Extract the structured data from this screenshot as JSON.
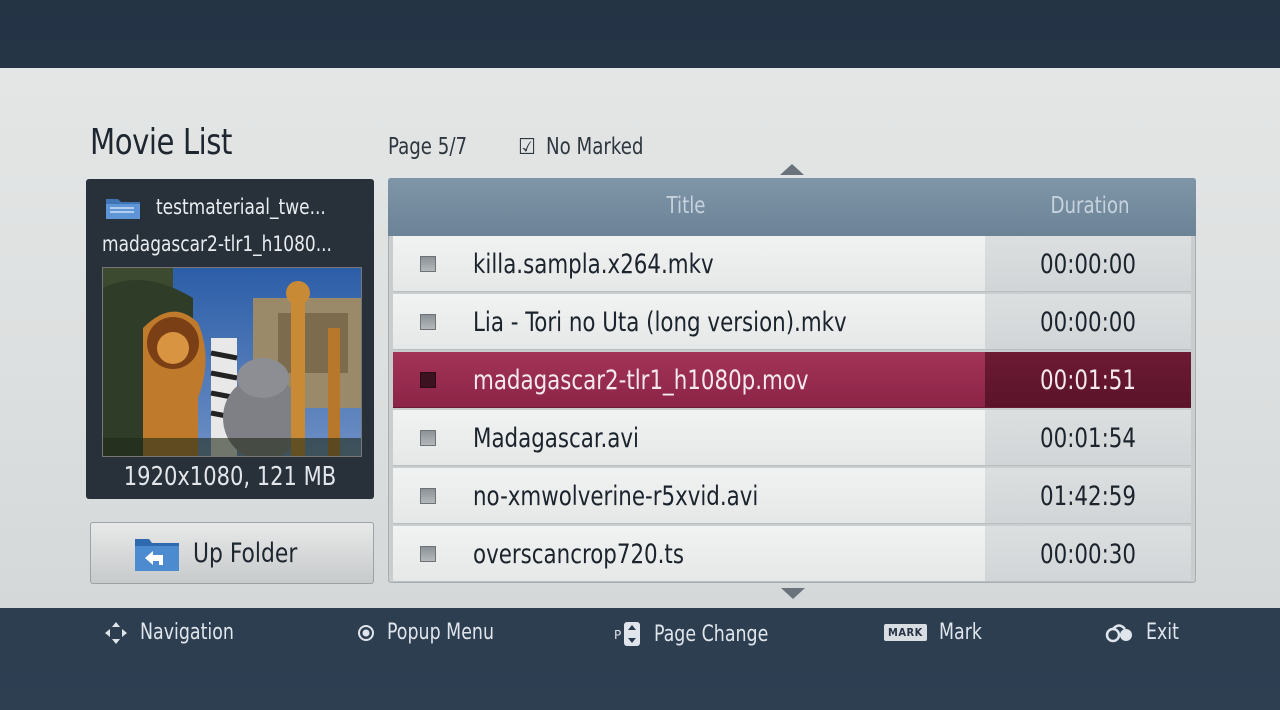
{
  "header": {
    "title": "Movie List",
    "page_indicator": "Page 5/7",
    "marked_status": "No Marked"
  },
  "preview": {
    "folder_name": "testmateriaal_twe...",
    "file_name": "madagascar2-tlr1_h1080...",
    "file_info": "1920x1080, 121 MB"
  },
  "up_folder": {
    "label": "Up Folder"
  },
  "list": {
    "columns": {
      "title": "Title",
      "duration": "Duration"
    },
    "rows": [
      {
        "title": "killa.sampla.x264.mkv",
        "duration": "00:00:00"
      },
      {
        "title": "Lia - Tori no Uta (long version).mkv",
        "duration": "00:00:00"
      },
      {
        "title": "madagascar2-tlr1_h1080p.mov",
        "duration": "00:01:51"
      },
      {
        "title": "Madagascar.avi",
        "duration": "00:01:54"
      },
      {
        "title": "no-xmwolverine-r5xvid.avi",
        "duration": "01:42:59"
      },
      {
        "title": "overscancrop720.ts",
        "duration": "00:00:30"
      }
    ],
    "selected_index": 2
  },
  "keys": {
    "navigation": "Navigation",
    "popup_menu": "Popup Menu",
    "page_change": "Page Change",
    "mark_badge": "MARK",
    "mark": "Mark",
    "exit": "Exit"
  },
  "colors": {
    "selection": "#9a2d50",
    "header_bar": "#7a8fa2",
    "panel": "#e0e3e3"
  }
}
